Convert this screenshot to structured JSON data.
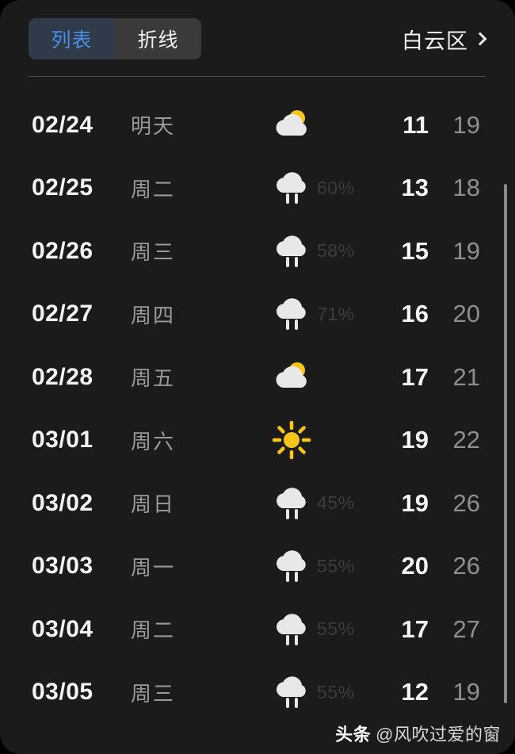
{
  "header": {
    "tabs": [
      {
        "label": "列表",
        "active": true,
        "name": "tab-list"
      },
      {
        "label": "折线",
        "active": false,
        "name": "tab-chart"
      }
    ],
    "location": "白云区",
    "chevron_icon": "chevron-right-icon"
  },
  "colors": {
    "background": "#1b1b1b",
    "active_tab_bg": "#2f3b4a",
    "active_tab_text": "#4a90e2",
    "inactive_tab_bg": "#3a3a38",
    "primary_text": "#f4f4f4",
    "secondary_text": "#9a9a9a",
    "dim_text": "#3c3c3c",
    "sun_yellow": "#f5c518",
    "cloud_white": "#e8e8e8",
    "scrollbar": "#8a8a8a"
  },
  "forecast": {
    "rows": [
      {
        "date": "02/24",
        "weekday": "明天",
        "icon": "partly-cloudy-icon",
        "pop": "",
        "low": "11",
        "high": "19"
      },
      {
        "date": "02/25",
        "weekday": "周二",
        "icon": "rain-icon",
        "pop": "60%",
        "low": "13",
        "high": "18"
      },
      {
        "date": "02/26",
        "weekday": "周三",
        "icon": "rain-icon",
        "pop": "58%",
        "low": "15",
        "high": "19"
      },
      {
        "date": "02/27",
        "weekday": "周四",
        "icon": "rain-icon",
        "pop": "71%",
        "low": "16",
        "high": "20"
      },
      {
        "date": "02/28",
        "weekday": "周五",
        "icon": "partly-cloudy-icon",
        "pop": "",
        "low": "17",
        "high": "21"
      },
      {
        "date": "03/01",
        "weekday": "周六",
        "icon": "sunny-icon",
        "pop": "",
        "low": "19",
        "high": "22"
      },
      {
        "date": "03/02",
        "weekday": "周日",
        "icon": "rain-icon",
        "pop": "45%",
        "low": "19",
        "high": "26"
      },
      {
        "date": "03/03",
        "weekday": "周一",
        "icon": "rain-icon",
        "pop": "55%",
        "low": "20",
        "high": "26"
      },
      {
        "date": "03/04",
        "weekday": "周二",
        "icon": "rain-icon",
        "pop": "55%",
        "low": "17",
        "high": "27"
      },
      {
        "date": "03/05",
        "weekday": "周三",
        "icon": "rain-icon",
        "pop": "55%",
        "low": "12",
        "high": "19"
      }
    ]
  },
  "watermark": {
    "brand": "头条",
    "user": "@风吹过爱的窗"
  }
}
